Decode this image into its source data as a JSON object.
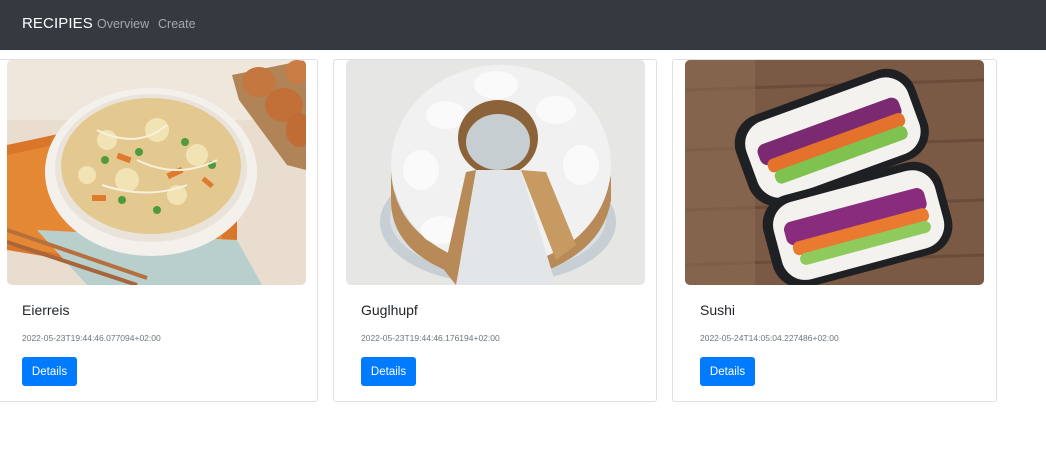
{
  "navbar": {
    "brand": "RECIPIES",
    "links": [
      "Overview",
      "Create"
    ],
    "background": "#343a40"
  },
  "recipes": [
    {
      "title": "Eierreis",
      "date": "2022-05-23T19:44:46.077094+02:00",
      "button": "Details",
      "image_icon": "fried-rice-photo"
    },
    {
      "title": "Guglhupf",
      "date": "2022-05-23T19:44:46.176194+02:00",
      "button": "Details",
      "image_icon": "bundt-cake-photo"
    },
    {
      "title": "Sushi",
      "date": "2022-05-24T14:05:04.227486+02:00",
      "button": "Details",
      "image_icon": "sushi-sandwich-photo"
    }
  ],
  "colors": {
    "accent": "#007bff"
  }
}
